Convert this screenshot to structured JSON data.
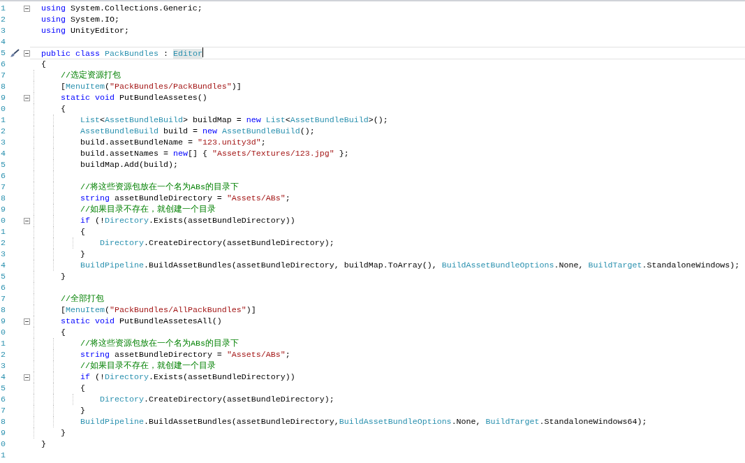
{
  "lines": [
    {
      "number": "1",
      "expanded": true,
      "tokens": [
        {
          "kind": "keyword",
          "text": "using"
        },
        {
          "kind": "plain",
          "text": " System.Collections.Generic;"
        }
      ]
    },
    {
      "number": "2",
      "tokens": [
        {
          "kind": "keyword",
          "text": "using"
        },
        {
          "kind": "plain",
          "text": " System.IO;"
        }
      ]
    },
    {
      "number": "3",
      "tokens": [
        {
          "kind": "keyword",
          "text": "using"
        },
        {
          "kind": "plain",
          "text": " UnityEditor;"
        }
      ]
    },
    {
      "number": "4"
    },
    {
      "number": "5",
      "expanded": true,
      "current": true,
      "quick_action": true,
      "tokens": [
        {
          "kind": "keyword",
          "text": "public class"
        },
        {
          "kind": "type",
          "text": " PackBundles"
        },
        {
          "kind": "plain",
          "text": " : "
        },
        {
          "kind": "type",
          "text": "Editor",
          "highlighted": true,
          "caret": true
        }
      ]
    },
    {
      "number": "6",
      "tokens": [
        {
          "kind": "plain",
          "text": "{"
        }
      ],
      "children": [
        {
          "number": "7",
          "tokens": [
            {
              "kind": "comment",
              "text": "//选定资源打包"
            }
          ]
        },
        {
          "number": "8",
          "tokens": [
            {
              "kind": "plain",
              "text": "["
            },
            {
              "kind": "type",
              "text": "MenuItem"
            },
            {
              "kind": "plain",
              "text": "("
            },
            {
              "kind": "string",
              "text": "\"PackBundles/PackBundles\""
            },
            {
              "kind": "plain",
              "text": ")]"
            }
          ]
        },
        {
          "number": "9",
          "expanded": true,
          "tokens": [
            {
              "kind": "keyword",
              "text": "static void"
            },
            {
              "kind": "plain",
              "text": " PutBundleAssetes()"
            }
          ]
        },
        {
          "number": "0",
          "tokens": [
            {
              "kind": "plain",
              "text": "{"
            }
          ],
          "children": [
            {
              "number": "1",
              "tokens": [
                {
                  "kind": "type",
                  "text": "List"
                },
                {
                  "kind": "plain",
                  "text": "<"
                },
                {
                  "kind": "type",
                  "text": "AssetBundleBuild"
                },
                {
                  "kind": "plain",
                  "text": "> buildMap = "
                },
                {
                  "kind": "keyword",
                  "text": "new"
                },
                {
                  "kind": "type",
                  "text": " List"
                },
                {
                  "kind": "plain",
                  "text": "<"
                },
                {
                  "kind": "type",
                  "text": "AssetBundleBuild"
                },
                {
                  "kind": "plain",
                  "text": ">();"
                }
              ]
            },
            {
              "number": "2",
              "tokens": [
                {
                  "kind": "type",
                  "text": "AssetBundleBuild"
                },
                {
                  "kind": "plain",
                  "text": " build = "
                },
                {
                  "kind": "keyword",
                  "text": "new"
                },
                {
                  "kind": "type",
                  "text": " AssetBundleBuild"
                },
                {
                  "kind": "plain",
                  "text": "();"
                }
              ]
            },
            {
              "number": "3",
              "tokens": [
                {
                  "kind": "plain",
                  "text": "build.assetBundleName = "
                },
                {
                  "kind": "string",
                  "text": "\"123.unity3d\""
                },
                {
                  "kind": "plain",
                  "text": ";"
                }
              ]
            },
            {
              "number": "4",
              "tokens": [
                {
                  "kind": "plain",
                  "text": "build.assetNames = "
                },
                {
                  "kind": "keyword",
                  "text": "new"
                },
                {
                  "kind": "plain",
                  "text": "[] { "
                },
                {
                  "kind": "string",
                  "text": "\"Assets/Textures/123.jpg\""
                },
                {
                  "kind": "plain",
                  "text": " };"
                }
              ]
            },
            {
              "number": "5",
              "tokens": [
                {
                  "kind": "plain",
                  "text": "buildMap.Add(build);"
                }
              ]
            },
            {
              "number": "6"
            },
            {
              "number": "7",
              "tokens": [
                {
                  "kind": "comment",
                  "text": "//将这些资源包放在一个名为ABs的目录下"
                }
              ]
            },
            {
              "number": "8",
              "tokens": [
                {
                  "kind": "keyword",
                  "text": "string"
                },
                {
                  "kind": "plain",
                  "text": " assetBundleDirectory = "
                },
                {
                  "kind": "string",
                  "text": "\"Assets/ABs\""
                },
                {
                  "kind": "plain",
                  "text": ";"
                }
              ]
            },
            {
              "number": "9",
              "tokens": [
                {
                  "kind": "comment",
                  "text": "//如果目录不存在，就创建一个目录"
                }
              ]
            },
            {
              "number": "0",
              "expanded": true,
              "tokens": [
                {
                  "kind": "keyword",
                  "text": "if"
                },
                {
                  "kind": "plain",
                  "text": " (!"
                },
                {
                  "kind": "type",
                  "text": "Directory"
                },
                {
                  "kind": "plain",
                  "text": ".Exists(assetBundleDirectory))"
                }
              ]
            },
            {
              "number": "1",
              "tokens": [
                {
                  "kind": "plain",
                  "text": "{"
                }
              ],
              "children": [
                {
                  "number": "2",
                  "tokens": [
                    {
                      "kind": "type",
                      "text": "Directory"
                    },
                    {
                      "kind": "plain",
                      "text": ".CreateDirectory(assetBundleDirectory);"
                    }
                  ]
                }
              ]
            },
            {
              "number": "3",
              "tokens": [
                {
                  "kind": "plain",
                  "text": "}"
                }
              ]
            },
            {
              "number": "4",
              "tokens": [
                {
                  "kind": "type",
                  "text": "BuildPipeline"
                },
                {
                  "kind": "plain",
                  "text": ".BuildAssetBundles(assetBundleDirectory, buildMap.ToArray(), "
                },
                {
                  "kind": "type",
                  "text": "BuildAssetBundleOptions"
                },
                {
                  "kind": "plain",
                  "text": ".None, "
                },
                {
                  "kind": "type",
                  "text": "BuildTarget"
                },
                {
                  "kind": "plain",
                  "text": ".StandaloneWindows);"
                }
              ]
            }
          ]
        },
        {
          "number": "5",
          "tokens": [
            {
              "kind": "plain",
              "text": "}"
            }
          ]
        },
        {
          "number": "6"
        },
        {
          "number": "7",
          "tokens": [
            {
              "kind": "comment",
              "text": "//全部打包"
            }
          ]
        },
        {
          "number": "8",
          "tokens": [
            {
              "kind": "plain",
              "text": "["
            },
            {
              "kind": "type",
              "text": "MenuItem"
            },
            {
              "kind": "plain",
              "text": "("
            },
            {
              "kind": "string",
              "text": "\"PackBundles/AllPackBundles\""
            },
            {
              "kind": "plain",
              "text": ")]"
            }
          ]
        },
        {
          "number": "9",
          "expanded": true,
          "tokens": [
            {
              "kind": "keyword",
              "text": "static void"
            },
            {
              "kind": "plain",
              "text": " PutBundleAssetesAll()"
            }
          ]
        },
        {
          "number": "0",
          "tokens": [
            {
              "kind": "plain",
              "text": "{"
            }
          ],
          "children": [
            {
              "number": "1",
              "tokens": [
                {
                  "kind": "comment",
                  "text": "//将这些资源包放在一个名为ABs的目录下"
                }
              ]
            },
            {
              "number": "2",
              "tokens": [
                {
                  "kind": "keyword",
                  "text": "string"
                },
                {
                  "kind": "plain",
                  "text": " assetBundleDirectory = "
                },
                {
                  "kind": "string",
                  "text": "\"Assets/ABs\""
                },
                {
                  "kind": "plain",
                  "text": ";"
                }
              ]
            },
            {
              "number": "3",
              "tokens": [
                {
                  "kind": "comment",
                  "text": "//如果目录不存在，就创建一个目录"
                }
              ]
            },
            {
              "number": "4",
              "expanded": true,
              "tokens": [
                {
                  "kind": "keyword",
                  "text": "if"
                },
                {
                  "kind": "plain",
                  "text": " (!"
                },
                {
                  "kind": "type",
                  "text": "Directory"
                },
                {
                  "kind": "plain",
                  "text": ".Exists(assetBundleDirectory))"
                }
              ]
            },
            {
              "number": "5",
              "tokens": [
                {
                  "kind": "plain",
                  "text": "{"
                }
              ],
              "children": [
                {
                  "number": "6",
                  "tokens": [
                    {
                      "kind": "type",
                      "text": "Directory"
                    },
                    {
                      "kind": "plain",
                      "text": ".CreateDirectory(assetBundleDirectory);"
                    }
                  ]
                }
              ]
            },
            {
              "number": "7",
              "tokens": [
                {
                  "kind": "plain",
                  "text": "}"
                }
              ]
            },
            {
              "number": "8",
              "tokens": [
                {
                  "kind": "type",
                  "text": "BuildPipeline"
                },
                {
                  "kind": "plain",
                  "text": ".BuildAssetBundles(assetBundleDirectory,"
                },
                {
                  "kind": "type",
                  "text": "BuildAssetBundleOptions"
                },
                {
                  "kind": "plain",
                  "text": ".None, "
                },
                {
                  "kind": "type",
                  "text": "BuildTarget"
                },
                {
                  "kind": "plain",
                  "text": ".StandaloneWindows64);"
                }
              ]
            }
          ]
        },
        {
          "number": "9",
          "tokens": [
            {
              "kind": "plain",
              "text": "}"
            }
          ]
        }
      ]
    },
    {
      "number": "0",
      "tokens": [
        {
          "kind": "plain",
          "text": "}"
        }
      ]
    },
    {
      "number": "1"
    }
  ]
}
